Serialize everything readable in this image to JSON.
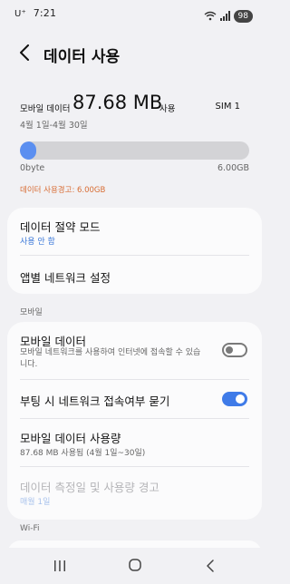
{
  "status_bar": {
    "carrier": "U⁺",
    "time": "7:21",
    "battery": "98"
  },
  "header": {
    "title": "데이터 사용"
  },
  "usage": {
    "label": "모바일 데이터",
    "amount": "87.68 MB",
    "unit": "사용",
    "sim": "SIM 1",
    "period": "4월 1일-4월 30일",
    "progress_fraction": 0.014,
    "bar_min": "0byte",
    "bar_max": "6.00GB",
    "warning": "데이터 사용경고: 6.00GB"
  },
  "card1": {
    "saver": {
      "title": "데이터 절약 모드",
      "status": "사용 안 함"
    },
    "app_network": {
      "title": "앱별 네트워크 설정"
    }
  },
  "mobile_section": {
    "header": "모바일",
    "mobile_data": {
      "title": "모바일 데이터",
      "desc": "모바일 네트워크를 사용하여 인터넷에 접속할 수 있습니다.",
      "enabled": false
    },
    "boot_ask": {
      "title": "부팅 시 네트워크 접속여부 묻기",
      "enabled": true
    },
    "mobile_usage": {
      "title": "모바일 데이터 사용량",
      "sub": "87.68 MB 사용됨 (4월 1일~30일)"
    },
    "cycle": {
      "title": "데이터 측정일 및 사용량 경고",
      "sub": "매월 1일"
    }
  },
  "wifi_section": {
    "header": "Wi-Fi"
  },
  "colors": {
    "accent": "#3f7be8",
    "warning": "#d86c33",
    "bar_fill": "#5b8ff0"
  },
  "icons": {
    "back": "back-arrow-icon",
    "wifi": "wifi-icon",
    "signal": "signal-icon",
    "recent": "recent-apps-icon",
    "home": "home-icon",
    "nav_back": "nav-back-icon"
  }
}
